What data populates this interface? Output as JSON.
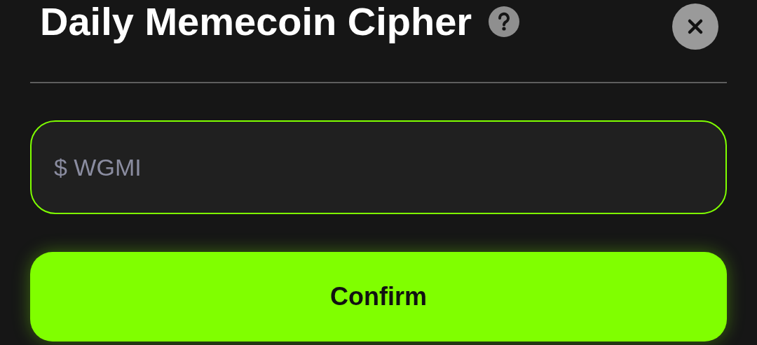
{
  "dialog": {
    "title": "Daily Memecoin Cipher"
  },
  "input": {
    "placeholder": "$ WGMI",
    "focused": true
  },
  "buttons": [
    {
      "label": "Confirm",
      "kind": "primary"
    }
  ]
}
